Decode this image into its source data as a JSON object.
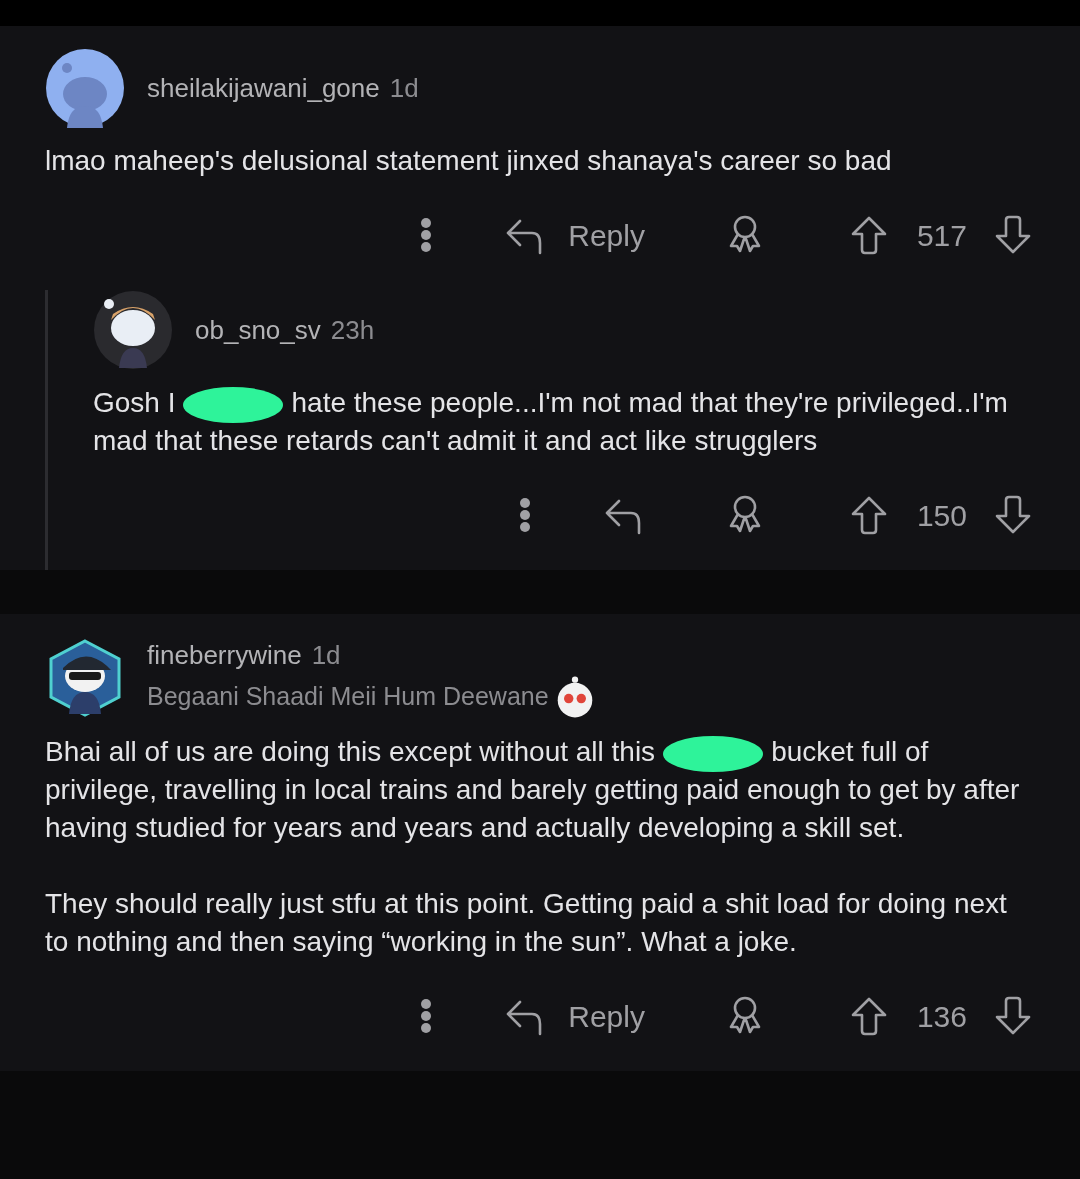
{
  "comments": [
    {
      "author": "sheilakijawani_gone",
      "age": "1d",
      "body": [
        [
          {
            "kind": "text",
            "text": "lmao maheep's delusional statement jinxed shanaya's career so bad"
          }
        ]
      ],
      "reply_label": "Reply",
      "score": "517",
      "replies": [
        {
          "author": "ob_sno_sv",
          "age": "23h",
          "body": [
            [
              {
                "kind": "text",
                "text": "Gosh I"
              },
              {
                "kind": "redaction"
              },
              {
                "kind": "text",
                "text": "hate these people...I'm not mad that they're privileged..I'm mad that these retards can't admit it and act like strugglers"
              }
            ]
          ],
          "score": "150"
        }
      ]
    },
    {
      "author": "fineberrywine",
      "age": "1d",
      "flair": "Begaani Shaadi Meii Hum Deewane",
      "body": [
        [
          {
            "kind": "text",
            "text": "Bhai all of us are doing this except without all this"
          },
          {
            "kind": "redaction"
          },
          {
            "kind": "text",
            "text": "bucket full of privilege, travelling in local trains and barely getting paid enough to get by after having studied for years and years and actually developing a skill set."
          }
        ],
        [
          {
            "kind": "text",
            "text": "They should really just stfu at this point. Getting paid a shit load for doing next to nothing and then saying “working in the sun”. What a joke."
          }
        ]
      ],
      "reply_label": "Reply",
      "score": "136"
    }
  ]
}
